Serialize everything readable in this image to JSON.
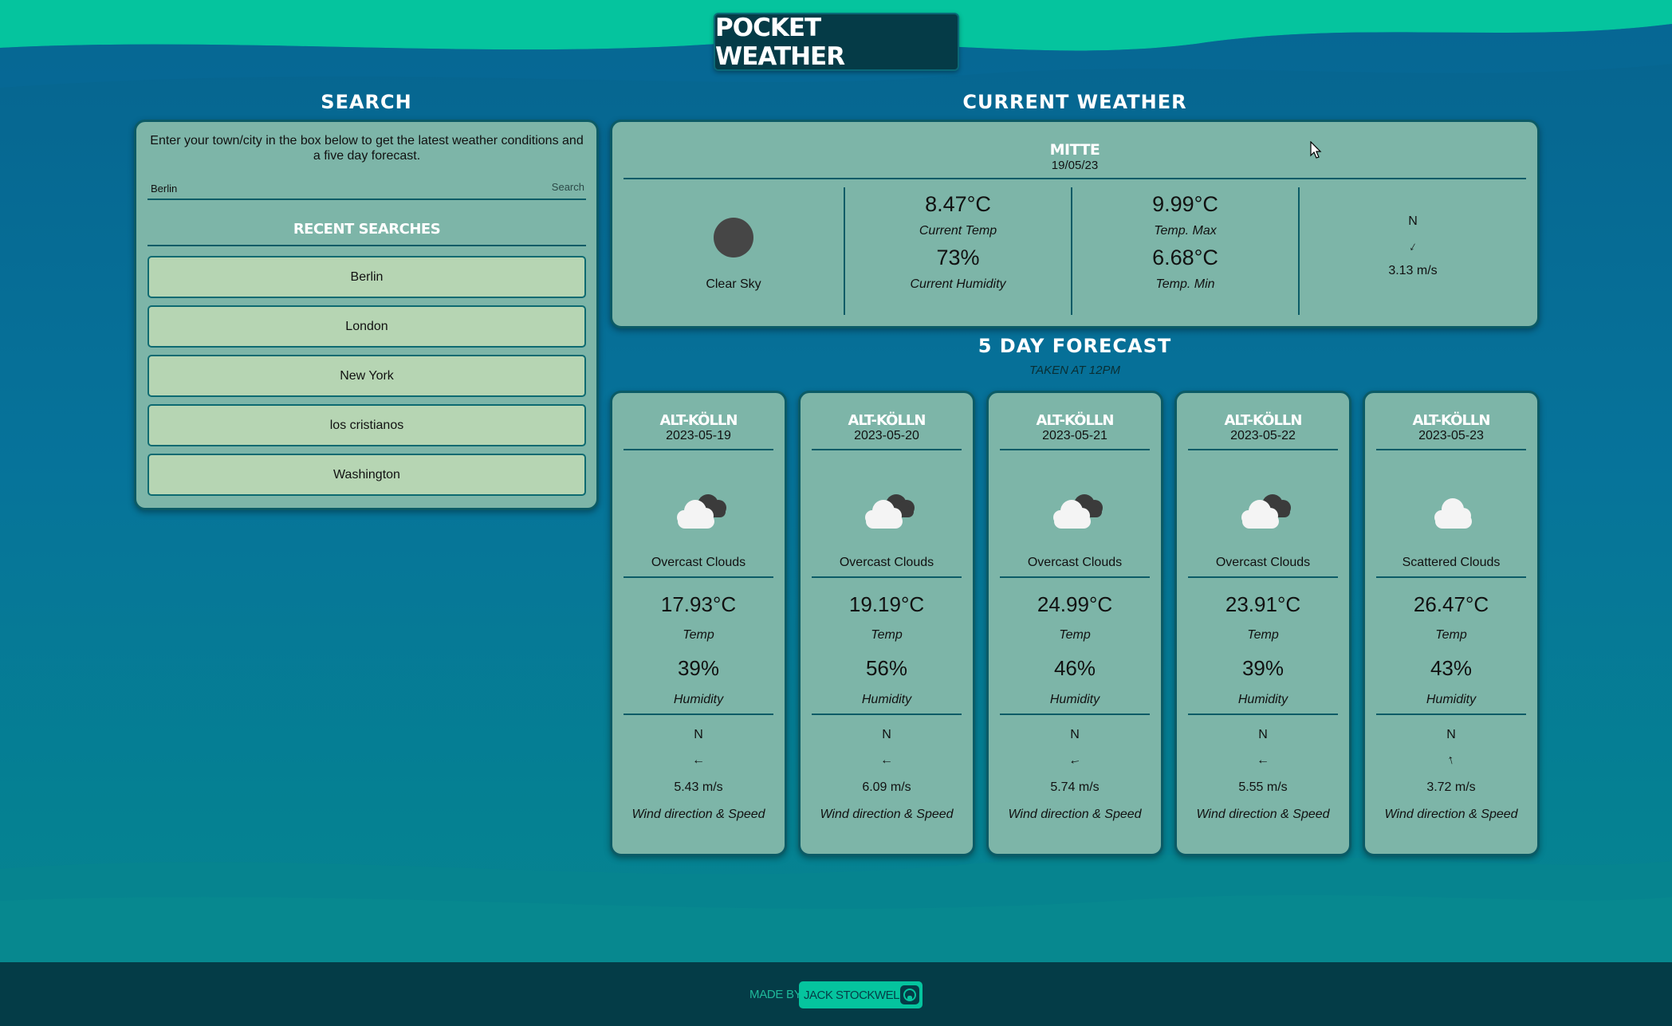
{
  "app": {
    "title": "POCKET WEATHER"
  },
  "search": {
    "heading": "SEARCH",
    "intro": "Enter your town/city in the box below to get the latest weather conditions and a five day forecast.",
    "input_value": "Berlin",
    "button_label": "Search",
    "recent_heading": "RECENT SEARCHES",
    "recent": [
      "Berlin",
      "London",
      "New York",
      "los cristianos",
      "Washington"
    ]
  },
  "current": {
    "heading": "CURRENT WEATHER",
    "city": "MITTE",
    "date": "19/05/23",
    "condition": "Clear Sky",
    "temp": "8.47°C",
    "temp_label": "Current Temp",
    "humidity": "73%",
    "humidity_label": "Current Humidity",
    "temp_max": "9.99°C",
    "temp_max_label": "Temp. Max",
    "temp_min": "6.68°C",
    "temp_min_label": "Temp. Min",
    "wind_dir_label": "N",
    "wind_arrow": "↓",
    "wind_speed": "3.13 m/s"
  },
  "forecast": {
    "heading": "5 DAY FORECAST",
    "subheading": "TAKEN AT 12PM",
    "days": [
      {
        "city": "ALT-KÖLLN",
        "date": "2023-05-19",
        "condition": "Overcast Clouds",
        "icon": "overcast-cloud-icon",
        "temp": "17.93°C",
        "temp_label": "Temp",
        "humidity": "39%",
        "humidity_label": "Humidity",
        "wind_dir_label": "N",
        "wind_arrow": "←",
        "wind_speed": "5.43 m/s",
        "wind_label": "Wind direction & Speed"
      },
      {
        "city": "ALT-KÖLLN",
        "date": "2023-05-20",
        "condition": "Overcast Clouds",
        "icon": "overcast-cloud-icon",
        "temp": "19.19°C",
        "temp_label": "Temp",
        "humidity": "56%",
        "humidity_label": "Humidity",
        "wind_dir_label": "N",
        "wind_arrow": "←",
        "wind_speed": "6.09 m/s",
        "wind_label": "Wind direction & Speed"
      },
      {
        "city": "ALT-KÖLLN",
        "date": "2023-05-21",
        "condition": "Overcast Clouds",
        "icon": "overcast-cloud-icon",
        "temp": "24.99°C",
        "temp_label": "Temp",
        "humidity": "46%",
        "humidity_label": "Humidity",
        "wind_dir_label": "N",
        "wind_arrow": "←",
        "wind_speed": "5.74 m/s",
        "wind_label": "Wind direction & Speed"
      },
      {
        "city": "ALT-KÖLLN",
        "date": "2023-05-22",
        "condition": "Overcast Clouds",
        "icon": "overcast-cloud-icon",
        "temp": "23.91°C",
        "temp_label": "Temp",
        "humidity": "39%",
        "humidity_label": "Humidity",
        "wind_dir_label": "N",
        "wind_arrow": "←",
        "wind_speed": "5.55 m/s",
        "wind_label": "Wind direction & Speed"
      },
      {
        "city": "ALT-KÖLLN",
        "date": "2023-05-23",
        "condition": "Scattered Clouds",
        "icon": "scattered-cloud-icon",
        "temp": "26.47°C",
        "temp_label": "Temp",
        "humidity": "43%",
        "humidity_label": "Humidity",
        "wind_dir_label": "N",
        "wind_arrow": "↑",
        "wind_speed": "3.72 m/s",
        "wind_label": "Wind direction & Speed"
      }
    ]
  },
  "footer": {
    "made_by": "MADE BY",
    "author": "JACK STOCKWELL",
    "author_icon": "github-icon"
  },
  "colors": {
    "accent": "#05c49e",
    "panel": "#7db5a8",
    "button": "#b6d5b3",
    "border": "#0b5b66",
    "footer": "#043c47"
  }
}
